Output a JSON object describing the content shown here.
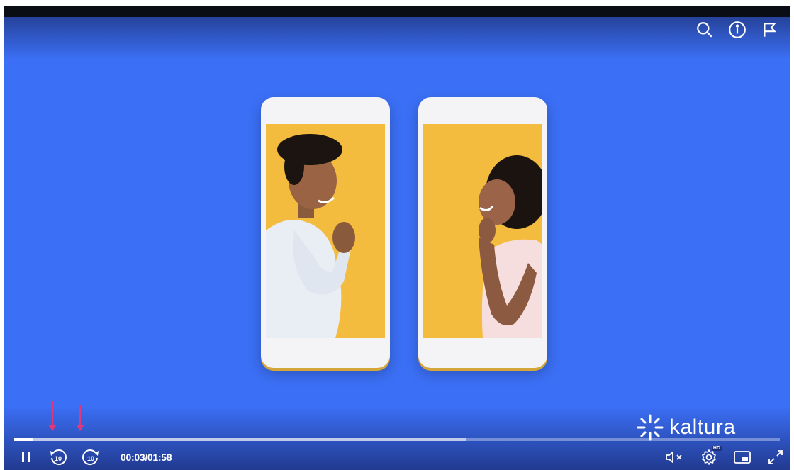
{
  "player": {
    "brand": "kaltura",
    "time_current": "00:03",
    "time_separator": "/",
    "time_total": "01:58",
    "progress_fraction": 0.025,
    "buffer_fraction": 0.59,
    "quality_badge": "HD",
    "accent_color": "#3b6ff5",
    "marker_color": "#e2367d"
  },
  "top_controls": [
    {
      "icon": "search-icon"
    },
    {
      "icon": "info-icon"
    },
    {
      "icon": "flag-icon"
    }
  ],
  "bottom_controls": [
    {
      "icon": "pause-icon"
    },
    {
      "icon": "rewind-10-icon",
      "label": "10"
    },
    {
      "icon": "forward-10-icon",
      "label": "10"
    },
    {
      "icon": "volume-muted-icon"
    },
    {
      "icon": "settings-icon"
    },
    {
      "icon": "picture-in-picture-icon"
    },
    {
      "icon": "fullscreen-icon"
    }
  ]
}
